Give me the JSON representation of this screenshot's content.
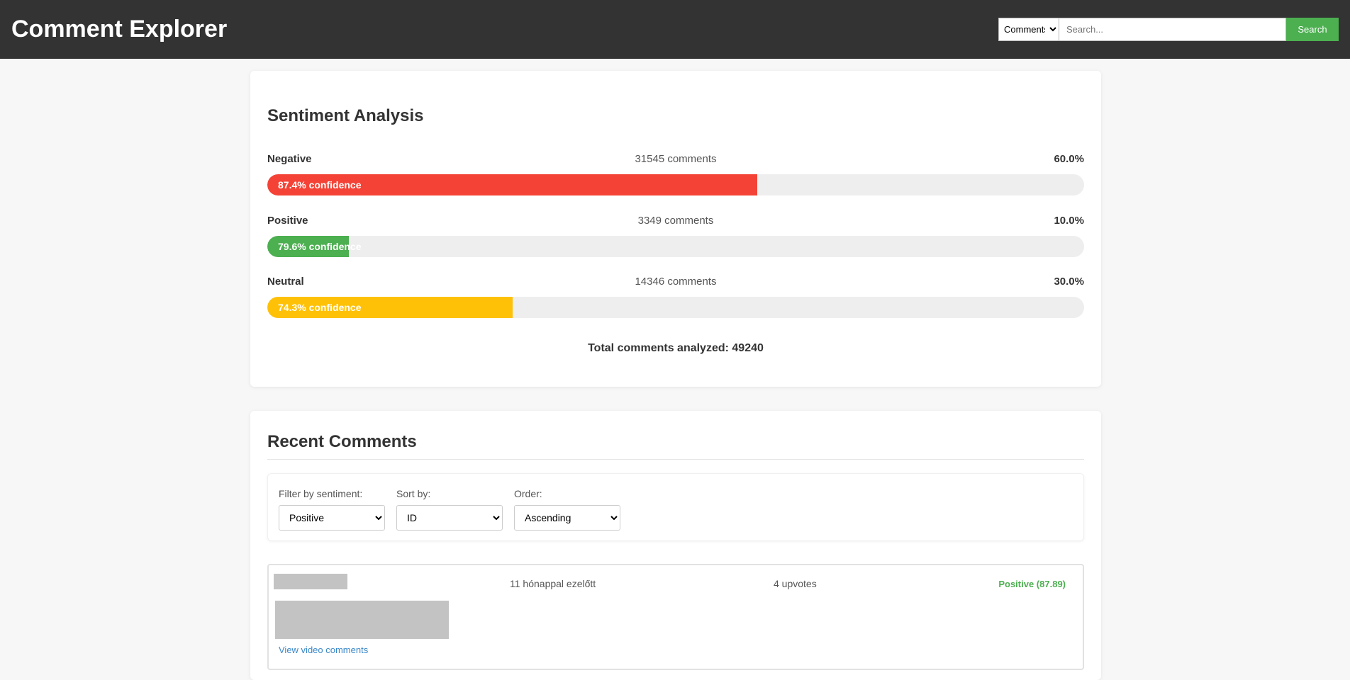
{
  "header": {
    "title": "Comment Explorer",
    "search": {
      "type_selected": "Comments",
      "placeholder": "Search...",
      "button_label": "Search"
    }
  },
  "sentiment": {
    "title": "Sentiment Analysis",
    "rows": [
      {
        "label": "Negative",
        "count_text": "31545 comments",
        "pct_text": "60.0%",
        "confidence_text": "87.4% confidence",
        "fraction": 0.6,
        "color": "#f44336"
      },
      {
        "label": "Positive",
        "count_text": "3349 comments",
        "pct_text": "10.0%",
        "confidence_text": "79.6% confidence",
        "fraction": 0.1,
        "color": "#4caf50"
      },
      {
        "label": "Neutral",
        "count_text": "14346 comments",
        "pct_text": "30.0%",
        "confidence_text": "74.3% confidence",
        "fraction": 0.3,
        "color": "#ffc107"
      }
    ],
    "total_text": "Total comments analyzed: 49240"
  },
  "recent": {
    "title": "Recent Comments",
    "filters": {
      "sentiment_label": "Filter by sentiment:",
      "sentiment_value": "Positive",
      "sort_label": "Sort by:",
      "sort_value": "ID",
      "order_label": "Order:",
      "order_value": "Ascending"
    },
    "comments": [
      {
        "date": "11 hónappal ezelőtt",
        "upvotes": "4 upvotes",
        "sentiment": "Positive (87.89)",
        "link": "View video comments"
      }
    ]
  }
}
